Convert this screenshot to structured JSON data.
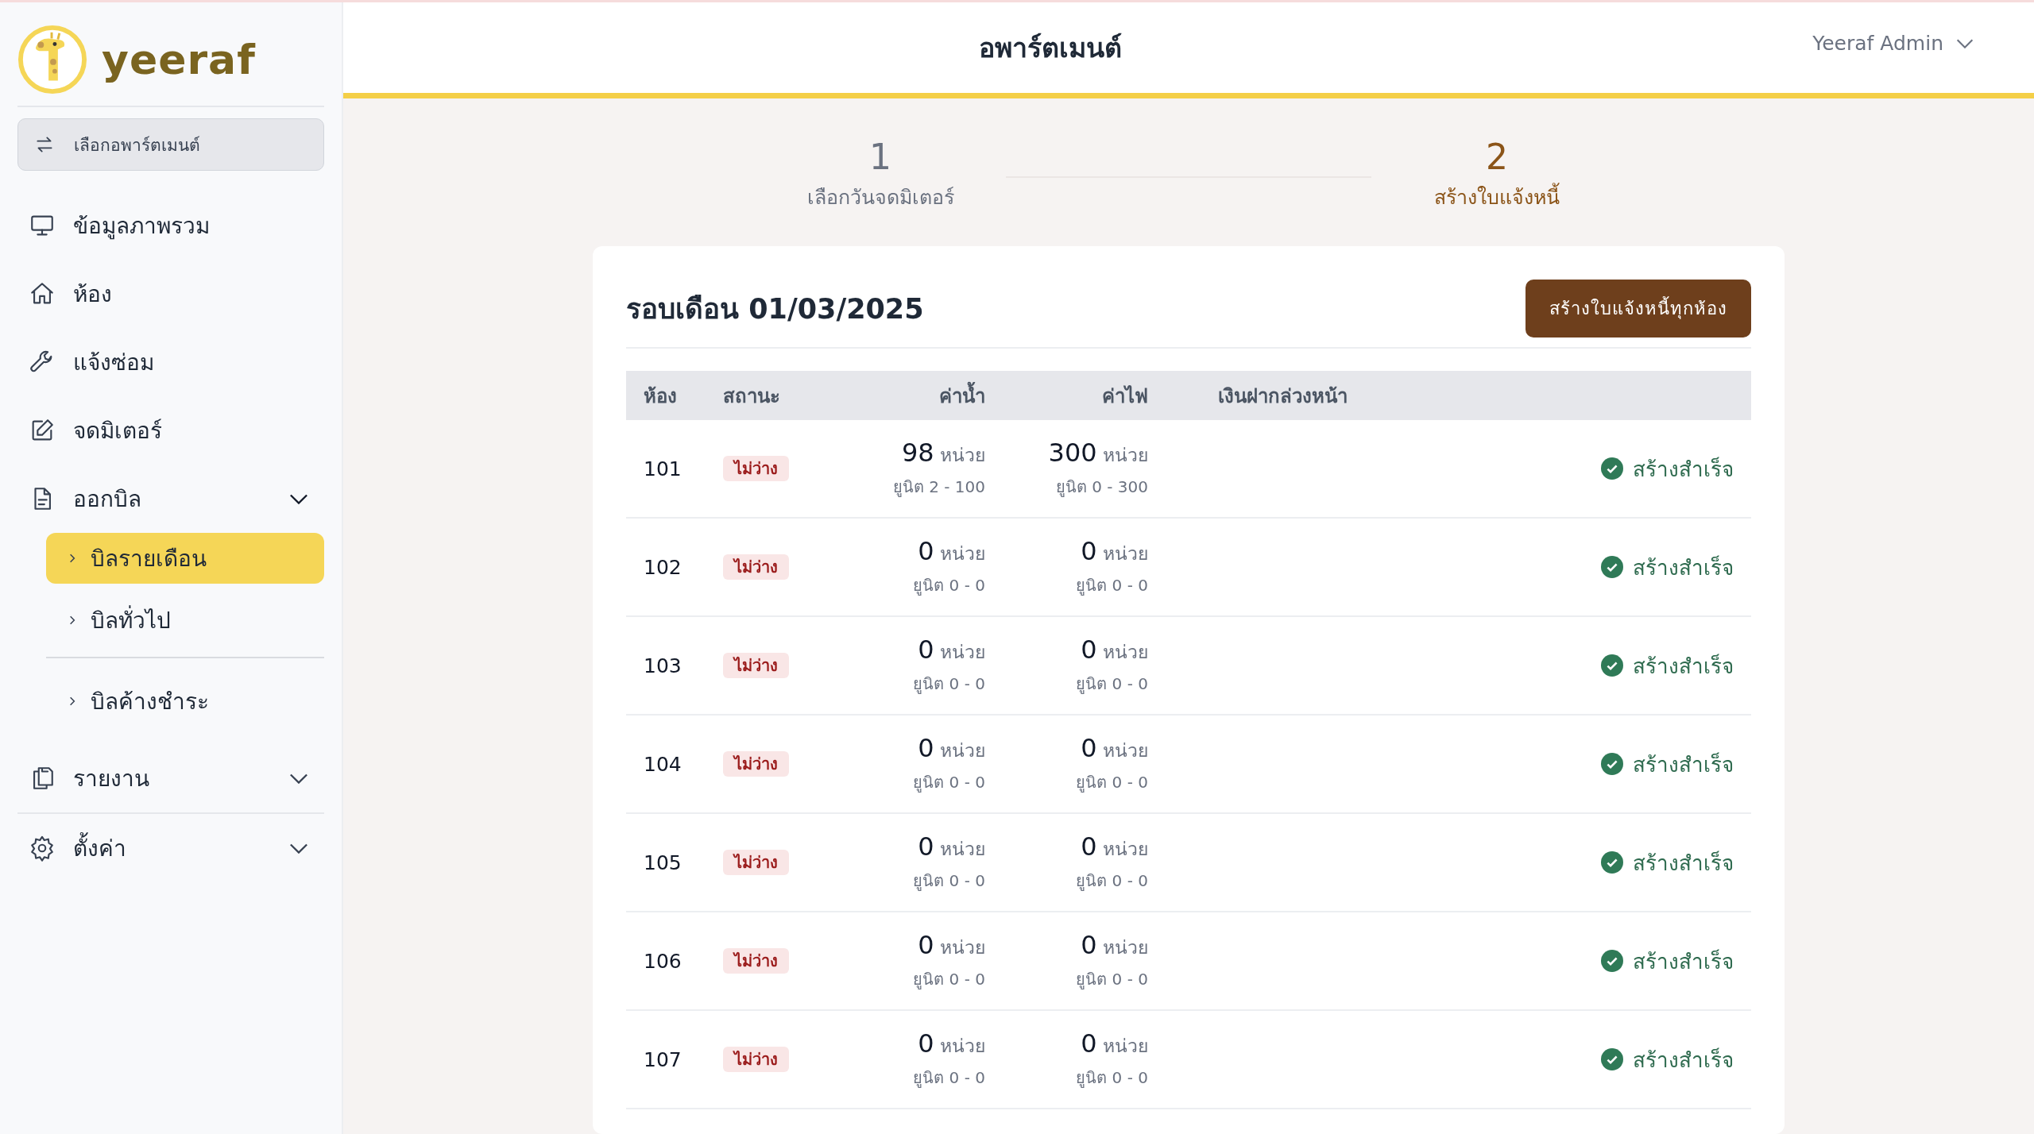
{
  "brand": {
    "name": "yeeraf"
  },
  "switch_button": {
    "label": "เลือกอพาร์ตเมนต์"
  },
  "sidebar": {
    "items": [
      {
        "label": "ข้อมูลภาพรวม",
        "selected": false
      },
      {
        "label": "ห้อง",
        "selected": false
      },
      {
        "label": "แจ้งซ่อม",
        "selected": false
      },
      {
        "label": "จดมิเตอร์",
        "selected": false
      },
      {
        "label": "ออกบิล",
        "selected": false,
        "expanded": true,
        "children": [
          {
            "label": "บิลรายเดือน",
            "selected": true
          },
          {
            "label": "บิลทั่วไป",
            "selected": false
          },
          {
            "label": "บิลค้างชำระ",
            "selected": false
          }
        ]
      },
      {
        "label": "รายงาน",
        "selected": false,
        "expanded": false
      },
      {
        "label": "ตั้งค่า",
        "selected": false,
        "expanded": false
      }
    ]
  },
  "header": {
    "title": "อพาร์ตเมนต์",
    "user": "Yeeraf Admin"
  },
  "steps": [
    {
      "number": "1",
      "label": "เลือกวันจดมิเตอร์",
      "selected": false
    },
    {
      "number": "2",
      "label": "สร้างใบแจ้งหนี้",
      "selected": true
    }
  ],
  "card": {
    "title": "รอบเดือน 01/03/2025",
    "action": "สร้างใบแจ้งหนี้ทุกห้อง"
  },
  "table": {
    "columns": [
      "ห้อง",
      "สถานะ",
      "ค่าน้ำ",
      "ค่าไฟ",
      "เงินฝากล่วงหน้า"
    ],
    "rows": [
      {
        "room": "101",
        "status": "ไม่ว่าง",
        "water": "98",
        "water_unit": "หน่วย",
        "water_range": "ยูนิต 2 - 100",
        "electric": "300",
        "electric_unit": "หน่วย",
        "electric_range": "ยูนิต 0 - 300",
        "result": "สร้างสำเร็จ"
      },
      {
        "room": "102",
        "status": "ไม่ว่าง",
        "water": "0",
        "water_unit": "หน่วย",
        "water_range": "ยูนิต 0 - 0",
        "electric": "0",
        "electric_unit": "หน่วย",
        "electric_range": "ยูนิต 0 - 0",
        "result": "สร้างสำเร็จ"
      },
      {
        "room": "103",
        "status": "ไม่ว่าง",
        "water": "0",
        "water_unit": "หน่วย",
        "water_range": "ยูนิต 0 - 0",
        "electric": "0",
        "electric_unit": "หน่วย",
        "electric_range": "ยูนิต 0 - 0",
        "result": "สร้างสำเร็จ"
      },
      {
        "room": "104",
        "status": "ไม่ว่าง",
        "water": "0",
        "water_unit": "หน่วย",
        "water_range": "ยูนิต 0 - 0",
        "electric": "0",
        "electric_unit": "หน่วย",
        "electric_range": "ยูนิต 0 - 0",
        "result": "สร้างสำเร็จ"
      },
      {
        "room": "105",
        "status": "ไม่ว่าง",
        "water": "0",
        "water_unit": "หน่วย",
        "water_range": "ยูนิต 0 - 0",
        "electric": "0",
        "electric_unit": "หน่วย",
        "electric_range": "ยูนิต 0 - 0",
        "result": "สร้างสำเร็จ"
      },
      {
        "room": "106",
        "status": "ไม่ว่าง",
        "water": "0",
        "water_unit": "หน่วย",
        "water_range": "ยูนิต 0 - 0",
        "electric": "0",
        "electric_unit": "หน่วย",
        "electric_range": "ยูนิต 0 - 0",
        "result": "สร้างสำเร็จ"
      },
      {
        "room": "107",
        "status": "ไม่ว่าง",
        "water": "0",
        "water_unit": "หน่วย",
        "water_range": "ยูนิต 0 - 0",
        "electric": "0",
        "electric_unit": "หน่วย",
        "electric_range": "ยูนิต 0 - 0",
        "result": "สร้างสำเร็จ"
      }
    ]
  }
}
